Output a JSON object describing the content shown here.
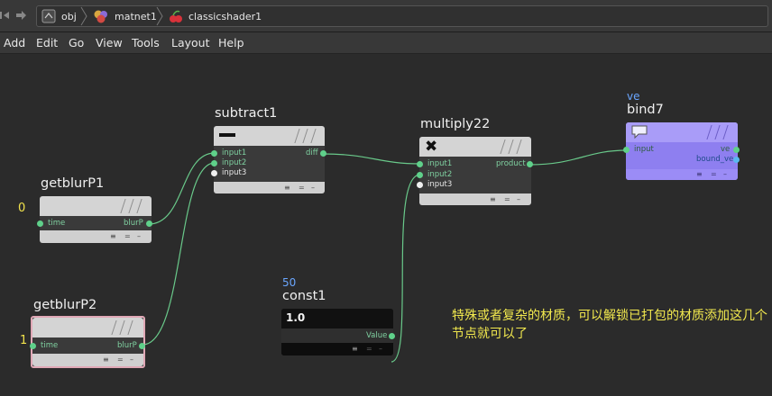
{
  "path": {
    "items": [
      {
        "label": "obj",
        "icon": "obj-icon"
      },
      {
        "label": "matnet1",
        "icon": "matnet-icon"
      },
      {
        "label": "classicshader1",
        "icon": "shader-icon"
      }
    ]
  },
  "menu": [
    "Add",
    "Edit",
    "Go",
    "View",
    "Tools",
    "Layout",
    "Help"
  ],
  "nodes": {
    "getblurP1": {
      "name": "getblurP1",
      "value": "0",
      "input": "time",
      "output": "blurP"
    },
    "getblurP2": {
      "name": "getblurP2",
      "value": "1",
      "input": "time",
      "output": "blurP"
    },
    "subtract1": {
      "name": "subtract1",
      "symbol": "—",
      "inputs": [
        "input1",
        "input2",
        "input3"
      ],
      "output": "diff"
    },
    "multiply22": {
      "name": "multiply22",
      "symbol": "✖",
      "inputs": [
        "input1",
        "input2",
        "input3"
      ],
      "output": "product"
    },
    "const1": {
      "name": "const1",
      "pre": "50",
      "display": "1.0",
      "output": "Value"
    },
    "bind7": {
      "name": "bind7",
      "pre": "ve",
      "input": "input",
      "outputs": [
        "ve",
        "bound_ve"
      ]
    }
  },
  "annotation": "特殊或者复杂的材质，可以解锁已打包的材质添加这几个节点就可以了",
  "colors": {
    "wire": "#69c98a",
    "annotation": "#f2e94e",
    "bind_node": "#9b8cf6",
    "node_header": "#d4d4d4",
    "background": "#2b2b2b"
  }
}
